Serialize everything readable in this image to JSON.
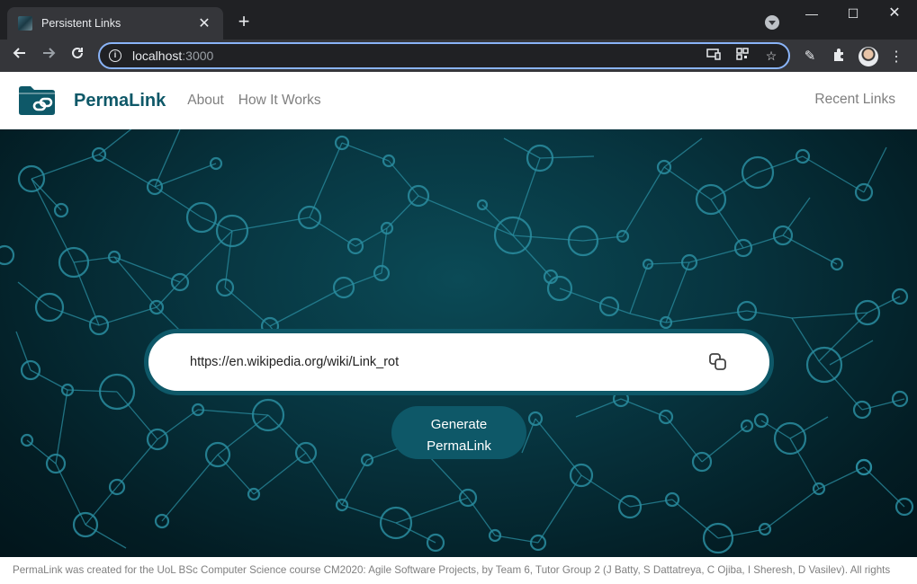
{
  "browser": {
    "tab_title": "Persistent Links",
    "tab_close": "✕",
    "new_tab": "+",
    "url_host": "localhost",
    "url_port": ":3000",
    "window_controls": {
      "minimize": "—",
      "maximize": "☐",
      "close": "✕"
    },
    "icons": [
      "info-icon",
      "cast-icon",
      "qr-code-icon",
      "bookmark-star-icon",
      "edit-pen-icon",
      "extensions-icon",
      "profile-avatar",
      "more-menu-icon"
    ]
  },
  "header": {
    "brand": "PermaLink",
    "nav": [
      {
        "label": "About"
      },
      {
        "label": "How It Works"
      }
    ],
    "recent_links": "Recent Links"
  },
  "hero": {
    "url_value": "https://en.wikipedia.org/wiki/Link_rot",
    "generate_label_line1": "Generate",
    "generate_label_line2": "PermaLink"
  },
  "footer": {
    "text": "PermaLink was created for the UoL BSc Computer Science course CM2020: Agile Software Projects, by Team 6, Tutor Group 2 (J Batty, S Dattatreya, C Ojiba, I Sheresh, D Vasilev). All rights"
  },
  "colors": {
    "brand": "#0e5868",
    "hero_dark": "#031d24",
    "network": "#2a8da0",
    "nav_text": "#7f7f7f",
    "omnibox_focus": "#8ab4f8"
  }
}
